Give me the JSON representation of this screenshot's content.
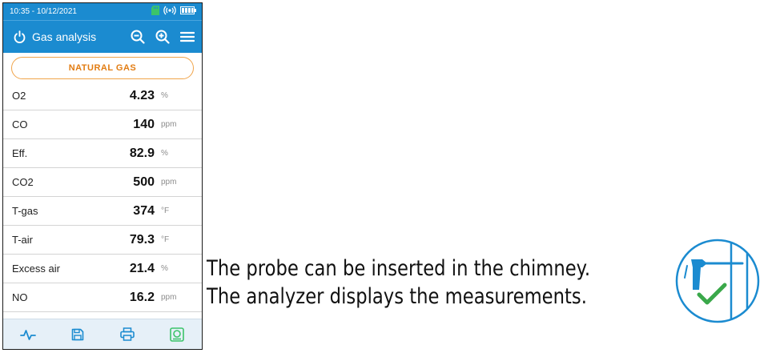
{
  "status_bar": {
    "datetime": "10:35 - 10/12/2021"
  },
  "app_bar": {
    "title": "Gas analysis"
  },
  "fuel": {
    "label": "NATURAL GAS"
  },
  "measurements": [
    {
      "label": "O2",
      "value": "4.23",
      "unit": "%"
    },
    {
      "label": "CO",
      "value": "140",
      "unit": "ppm"
    },
    {
      "label": "Eff.",
      "value": "82.9",
      "unit": "%"
    },
    {
      "label": "CO2",
      "value": "500",
      "unit": "ppm"
    },
    {
      "label": "T-gas",
      "value": "374",
      "unit": "°F"
    },
    {
      "label": "T-air",
      "value": "79.3",
      "unit": "°F"
    },
    {
      "label": "Excess air",
      "value": "21.4",
      "unit": "%"
    },
    {
      "label": "NO",
      "value": "16.2",
      "unit": "ppm"
    }
  ],
  "caption": {
    "line1": "The probe can be inserted in the chimney.",
    "line2": "The analyzer displays the measurements."
  },
  "colors": {
    "header_blue": "#1b8bd0",
    "fuel_orange": "#e27c12",
    "status_green": "#3cc46a",
    "bottom_icon_blue": "#1b8bd0",
    "check_green": "#3aa84a"
  },
  "icons": {
    "status": [
      "sd-card-icon",
      "wireless-signal-icon",
      "battery-icon"
    ],
    "app_bar": [
      "refresh-icon",
      "zoom-out-icon",
      "zoom-in-icon",
      "menu-icon"
    ],
    "bottom_bar": [
      "chart-icon",
      "save-icon",
      "print-icon",
      "probe-icon"
    ],
    "badge": [
      "probe-in-chimney-icon",
      "check-icon"
    ]
  }
}
